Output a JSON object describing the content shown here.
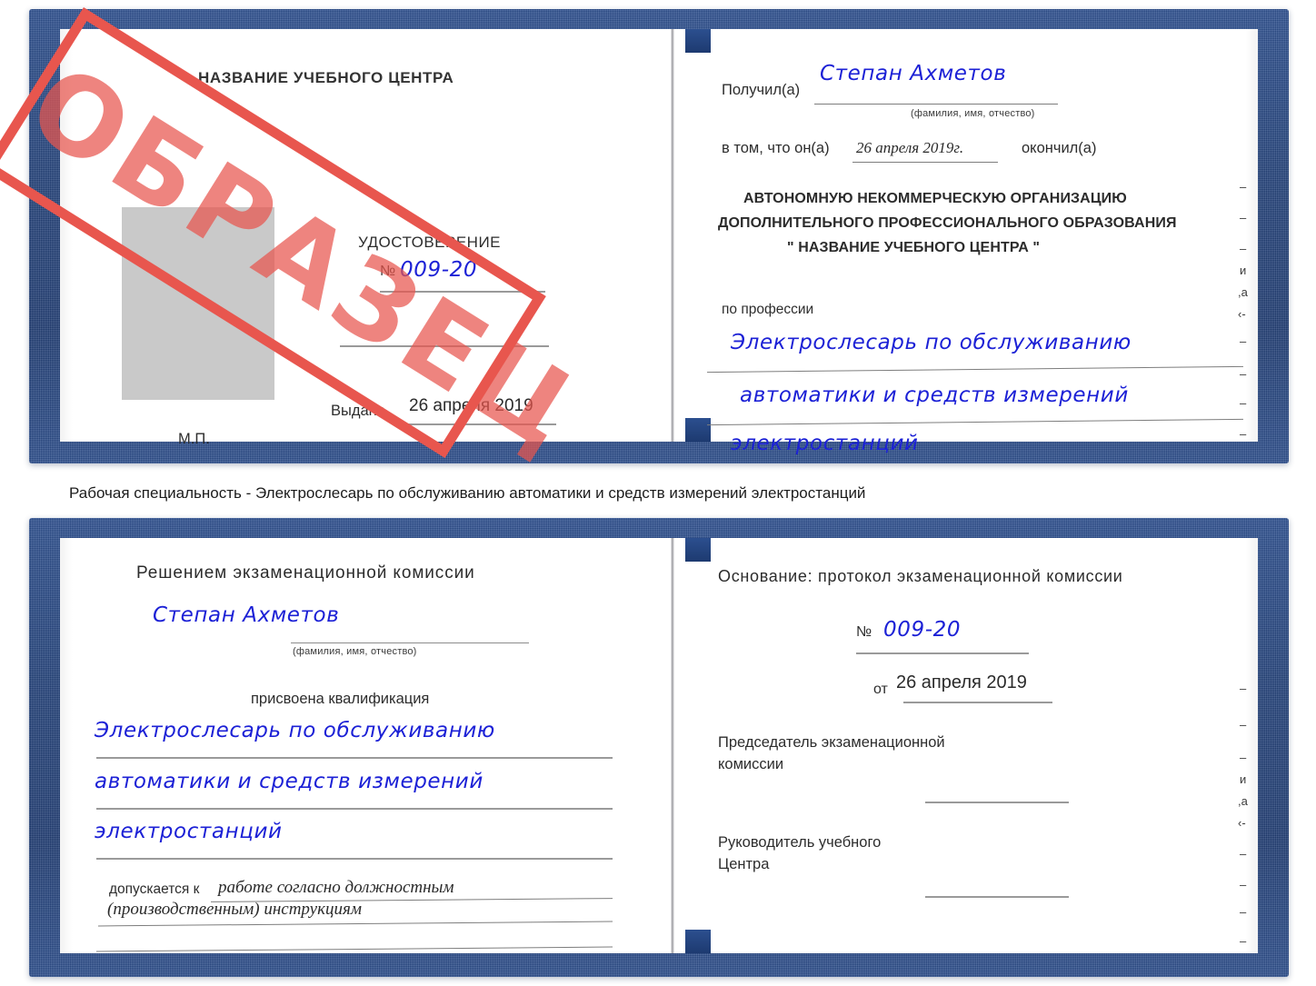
{
  "stamp": {
    "text": "ОБРАЗЕЦ",
    "color": "#e8564e"
  },
  "caption": {
    "text": "Рабочая специальность - Электрослесарь по обслуживанию автоматики и средств измерений электростанций"
  },
  "colors": {
    "cover_blue": "#22417a",
    "handwriting_blue": "#1c21d6",
    "stamp_red": "#e8564e",
    "photo_placeholder_gray": "#c9c9c9"
  },
  "certificate_top": {
    "left_page": {
      "center_name": "НАЗВАНИЕ УЧЕБНОГО ЦЕНТРА",
      "title": "УДОСТОВЕРЕНИЕ",
      "number_symbol": "№",
      "number_value": "009-20",
      "issued_label": "Выдано",
      "issued_value": "26 апреля 2019",
      "seal_label": "М.П."
    },
    "right_page": {
      "received_label": "Получил(а)",
      "received_value": "Степан Ахметов",
      "received_hint": "(фамилия, имя, отчество)",
      "in_that_label": "в том, что он(а)",
      "in_that_value": "26 апреля 2019г.",
      "finished_label": "окончил(а)",
      "organization_line1": "АВТОНОМНУЮ НЕКОММЕРЧЕСКУЮ ОРГАНИЗАЦИЮ",
      "organization_line2": "ДОПОЛНИТЕЛЬНОГО ПРОФЕССИОНАЛЬНОГО ОБРАЗОВАНИЯ",
      "organization_line3": "\"      НАЗВАНИЕ УЧЕБНОГО ЦЕНТРА           \"",
      "profession_label": "по профессии",
      "profession_line1": "Электрослесарь по обслуживанию",
      "profession_line2": "автоматики и средств измерений",
      "profession_line3": "электростанций",
      "edge_fragments": [
        "–",
        "–",
        "–",
        "и",
        ",а",
        "‹-",
        "–",
        "–",
        "–",
        "–"
      ]
    }
  },
  "certificate_bottom": {
    "left_page": {
      "decision_title": "Решением экзаменационной комиссии",
      "name_value": "Степан Ахметов",
      "name_hint": "(фамилия, имя, отчество)",
      "qualification_label": "присвоена квалификация",
      "qualification_line1": "Электрослесарь по обслуживанию",
      "qualification_line2": "автоматики и средств измерений",
      "qualification_line3": "электростанций",
      "allowed_label": "допускается к",
      "allowed_value_line1": "работе согласно должностным",
      "allowed_value_line2": "(производственным) инструкциям"
    },
    "right_page": {
      "basis_label": "Основание: протокол экзаменационной комиссии",
      "number_symbol": "№",
      "number_value": "009-20",
      "date_label": "от",
      "date_value": "26 апреля 2019",
      "chairman_line1": "Председатель экзаменационной",
      "chairman_line2": "комиссии",
      "head_line1": "Руководитель учебного",
      "head_line2": "Центра",
      "edge_fragments": [
        "–",
        "–",
        "–",
        "и",
        ",а",
        "‹-",
        "–",
        "–",
        "–",
        "–"
      ]
    }
  }
}
